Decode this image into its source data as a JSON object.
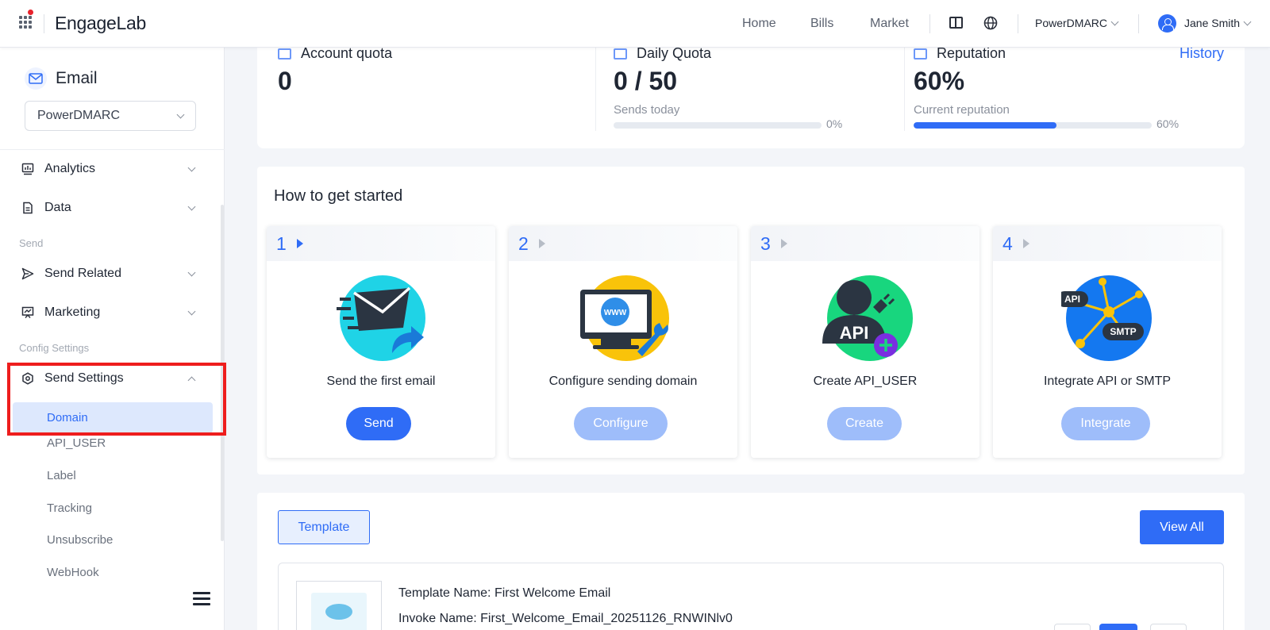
{
  "topbar": {
    "logo": "EngageLab",
    "nav": [
      "Home",
      "Bills",
      "Market"
    ],
    "org": "PowerDMARC",
    "user": "Jane Smith"
  },
  "sidebar": {
    "product": "Email",
    "org_select": "PowerDMARC",
    "items": {
      "analytics": "Analytics",
      "data": "Data",
      "send_group": "Send",
      "send_related": "Send Related",
      "marketing": "Marketing",
      "config_group": "Config Settings",
      "send_settings": "Send Settings"
    },
    "sub_items": [
      "Domain",
      "API_USER",
      "Label",
      "Tracking",
      "Unsubscribe",
      "WebHook"
    ]
  },
  "stats": {
    "account_quota": {
      "label": "Account quota",
      "value": "0"
    },
    "daily_quota": {
      "label": "Daily Quota",
      "value": "0 / 50",
      "sub": "Sends today",
      "progress": 0,
      "pct": "0%"
    },
    "reputation": {
      "label": "Reputation",
      "value": "60%",
      "sub": "Current reputation",
      "progress": 0.6,
      "pct": "60%",
      "link": "History"
    }
  },
  "get_started": {
    "title": "How to get started",
    "steps": [
      {
        "num": "1",
        "label": "Send the first email",
        "button": "Send"
      },
      {
        "num": "2",
        "label": "Configure sending domain",
        "button": "Configure"
      },
      {
        "num": "3",
        "label": "Create API_USER",
        "button": "Create"
      },
      {
        "num": "4",
        "label": "Integrate API or SMTP",
        "button": "Integrate"
      }
    ],
    "illus_text": {
      "www": "WWW",
      "api": "API",
      "api2": "API",
      "smtp": "SMTP"
    }
  },
  "templates": {
    "tab": "Template",
    "view_all": "View All",
    "row": {
      "name": "Template Name: First Welcome Email",
      "invoke": "Invoke Name: First_Welcome_Email_20251126_RNWINlv0"
    }
  },
  "colors": {
    "accent": "#2f6cf6",
    "highlight": "#ee1d1d"
  }
}
